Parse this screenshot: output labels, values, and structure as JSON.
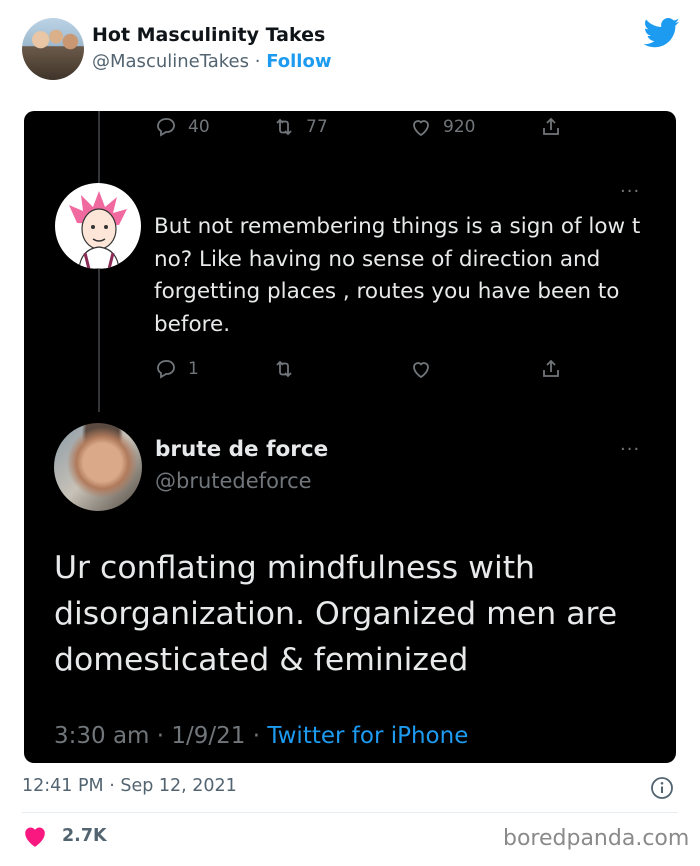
{
  "embed": {
    "author_name": "Hot Masculinity Takes",
    "author_handle": "@MasculineTakes",
    "separator": " · ",
    "follow_label": "Follow",
    "timestamp": "12:41 PM · Sep 12, 2021",
    "like_count": "2.7K",
    "watermark": "boredpanda.com",
    "accent_color": "#1d9bf0",
    "like_color": "#f91880"
  },
  "screenshot": {
    "top_actions": {
      "replies": "40",
      "retweets": "77",
      "likes": "920"
    },
    "reply_tweet": {
      "text": "But not remembering things is a sign of low t no? Like having no sense of direction and forgetting places , routes you have been to before.",
      "replies": "1",
      "more_label": "···"
    },
    "main_tweet": {
      "name": "brute de force",
      "handle": "@brutedeforce",
      "text": "Ur conflating mindfulness with disorganization.  Organized men are domesticated & feminized",
      "time": "3:30 am",
      "date": "1/9/21",
      "meta_sep": " · ",
      "source": "Twitter for iPhone",
      "more_label": "···"
    }
  }
}
